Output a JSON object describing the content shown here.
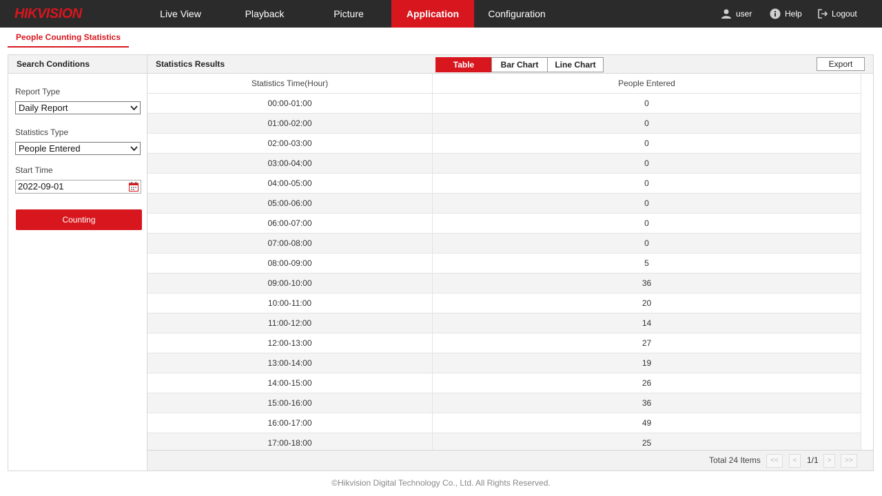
{
  "brand": {
    "logo_text": "HIKVISION",
    "accent": "#d7161e",
    "topbar_bg": "#2b2b2b"
  },
  "nav": [
    {
      "label": "Live View",
      "active": false
    },
    {
      "label": "Playback",
      "active": false
    },
    {
      "label": "Picture",
      "active": false
    },
    {
      "label": "Application",
      "active": true
    },
    {
      "label": "Configuration",
      "active": false
    }
  ],
  "user_menu": {
    "user": "user",
    "help": "Help",
    "logout": "Logout"
  },
  "subtab": "People Counting Statistics",
  "search": {
    "title": "Search Conditions",
    "report_type_label": "Report Type",
    "report_type_value": "Daily Report",
    "statistics_type_label": "Statistics Type",
    "statistics_type_value": "People Entered",
    "start_time_label": "Start Time",
    "start_time_value": "2022-09-01",
    "counting_button": "Counting"
  },
  "results": {
    "title": "Statistics Results",
    "view_tabs": [
      {
        "label": "Table",
        "active": true
      },
      {
        "label": "Bar Chart",
        "active": false
      },
      {
        "label": "Line Chart",
        "active": false
      }
    ],
    "export_label": "Export",
    "columns": [
      "Statistics Time(Hour)",
      "People Entered"
    ],
    "rows": [
      [
        "00:00-01:00",
        "0"
      ],
      [
        "01:00-02:00",
        "0"
      ],
      [
        "02:00-03:00",
        "0"
      ],
      [
        "03:00-04:00",
        "0"
      ],
      [
        "04:00-05:00",
        "0"
      ],
      [
        "05:00-06:00",
        "0"
      ],
      [
        "06:00-07:00",
        "0"
      ],
      [
        "07:00-08:00",
        "0"
      ],
      [
        "08:00-09:00",
        "5"
      ],
      [
        "09:00-10:00",
        "36"
      ],
      [
        "10:00-11:00",
        "20"
      ],
      [
        "11:00-12:00",
        "14"
      ],
      [
        "12:00-13:00",
        "27"
      ],
      [
        "13:00-14:00",
        "19"
      ],
      [
        "14:00-15:00",
        "26"
      ],
      [
        "15:00-16:00",
        "36"
      ],
      [
        "16:00-17:00",
        "49"
      ],
      [
        "17:00-18:00",
        "25"
      ]
    ],
    "total_text": "Total 24 Items",
    "pagination": {
      "first": "<<",
      "prev": "<",
      "page": "1/1",
      "next": ">",
      "last": ">>"
    }
  },
  "copyright": "©Hikvision Digital Technology Co., Ltd. All Rights Reserved."
}
